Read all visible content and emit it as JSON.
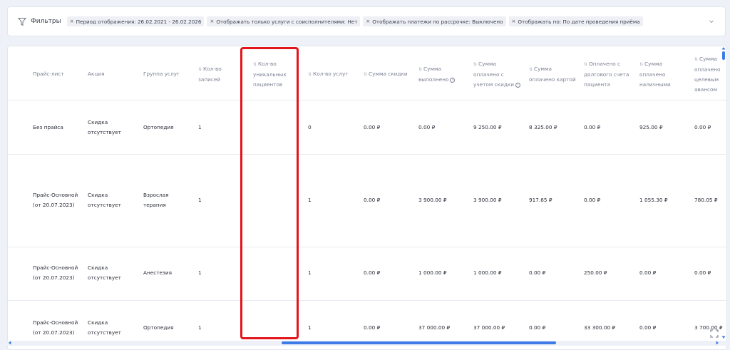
{
  "filters": {
    "title": "Фильтры",
    "chips": [
      "Период отображения: 26.02.2021 - 26.02.2026",
      "Отображать только услуги с соисполнителями: Нет",
      "Отображать платежи по рассрочке: Выключено",
      "Отображать по: По дате проведения приёма"
    ]
  },
  "table": {
    "columns": [
      {
        "lines": [
          "Прайс-лист"
        ],
        "sortable": false
      },
      {
        "lines": [
          "Акция"
        ],
        "sortable": false
      },
      {
        "lines": [
          "Группа услуг"
        ],
        "sortable": false
      },
      {
        "lines": [
          "Кол-во",
          "записей"
        ],
        "sortable": true
      },
      {
        "lines": [
          "Кол-во",
          "уникальных",
          "пациентов"
        ],
        "sortable": true
      },
      {
        "lines": [
          "Кол-во услуг"
        ],
        "sortable": true
      },
      {
        "lines": [
          "Сумма скидки"
        ],
        "sortable": true
      },
      {
        "lines": [
          "Сумма",
          "выполнено"
        ],
        "sortable": true,
        "info": true
      },
      {
        "lines": [
          "Сумма",
          "оплачено с",
          "учетом скидки"
        ],
        "sortable": true,
        "info": true
      },
      {
        "lines": [
          "Сумма",
          "оплачено картой"
        ],
        "sortable": true
      },
      {
        "lines": [
          "Оплачено с",
          "долгового счета",
          "пациента"
        ],
        "sortable": true
      },
      {
        "lines": [
          "Сумма",
          "оплачено",
          "наличными"
        ],
        "sortable": true
      },
      {
        "lines": [
          "Сумма",
          "оплачено",
          "целевым",
          "авансом"
        ],
        "sortable": true
      }
    ],
    "rows": [
      [
        [
          "Без прайса"
        ],
        [
          "Скидка",
          "отсутствует"
        ],
        [
          "Ортопедия"
        ],
        [
          "1"
        ],
        [
          ""
        ],
        [
          "0"
        ],
        [
          "0.00 ₽"
        ],
        [
          "0.00 ₽"
        ],
        [
          "9 250.00 ₽"
        ],
        [
          "8 325.00 ₽"
        ],
        [
          "0.00 ₽"
        ],
        [
          "925.00 ₽"
        ],
        [
          "0.00 ₽"
        ]
      ],
      [
        [
          "Прайс-Основной",
          "(от 20.07.2023)"
        ],
        [
          "Скидка",
          "отсутствует"
        ],
        [
          "Взрослая",
          "терапия"
        ],
        [
          "1"
        ],
        [
          ""
        ],
        [
          "1"
        ],
        [
          "0.00 ₽"
        ],
        [
          "3 900.00 ₽"
        ],
        [
          "3 900.00 ₽"
        ],
        [
          "917.65 ₽"
        ],
        [
          "0.00 ₽"
        ],
        [
          "1 055.30 ₽"
        ],
        [
          "780.05 ₽"
        ]
      ],
      [
        [
          "Прайс-Основной",
          "(от 20.07.2023)"
        ],
        [
          "Скидка",
          "отсутствует"
        ],
        [
          "Анестезия"
        ],
        [
          "1"
        ],
        [
          ""
        ],
        [
          "1"
        ],
        [
          "0.00 ₽"
        ],
        [
          "1 000.00 ₽"
        ],
        [
          "1 000.00 ₽"
        ],
        [
          "0.00 ₽"
        ],
        [
          "250.00 ₽"
        ],
        [
          "0.00 ₽"
        ],
        [
          "0.00 ₽"
        ]
      ],
      [
        [
          "Прайс-Основной",
          "(от 20.07.2023)"
        ],
        [
          "Скидка",
          "отсутствует"
        ],
        [
          "Ортопедия"
        ],
        [
          "1"
        ],
        [
          ""
        ],
        [
          "1"
        ],
        [
          "0.00 ₽"
        ],
        [
          "37 000.00 ₽"
        ],
        [
          "37 000.00 ₽"
        ],
        [
          "0.00 ₽"
        ],
        [
          "33 300.00 ₽"
        ],
        [
          "0.00 ₽"
        ],
        [
          "3 700.00 ₽"
        ]
      ]
    ]
  },
  "colors": {
    "accent": "#3e7be6",
    "highlight": "#e3141b"
  }
}
